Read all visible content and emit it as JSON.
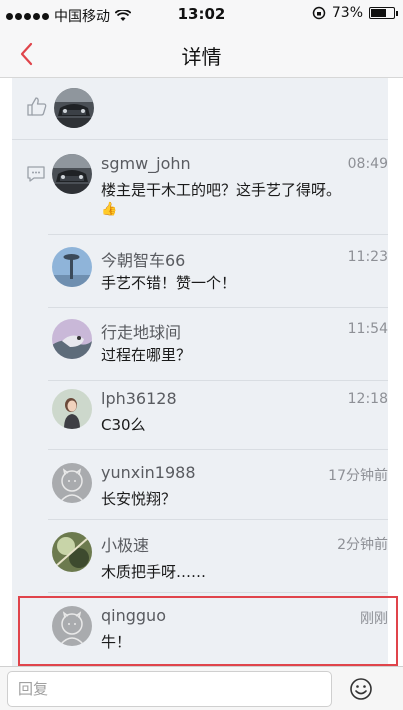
{
  "status_bar": {
    "carrier": "中国移动",
    "time": "13:02",
    "battery_text": "73%",
    "battery_level": 0.73
  },
  "nav": {
    "title": "详情"
  },
  "comments": [
    {
      "name": "sgmw_john",
      "time": "08:49",
      "text": "楼主是干木工的吧？这手艺了得呀。",
      "emoji": "👍"
    },
    {
      "name": "今朝智车66",
      "time": "11:23",
      "text": "手艺不错！赞一个！"
    },
    {
      "name": "行走地球间",
      "time": "11:54",
      "text": "过程在哪里？"
    },
    {
      "name": "lph36128",
      "time": "12:18",
      "text": "C30么"
    },
    {
      "name": "yunxin1988",
      "time": "17分钟前",
      "text": "长安悦翔？"
    },
    {
      "name": "小极速",
      "time": "2分钟前",
      "text": "木质把手呀……"
    },
    {
      "name": "qingguo",
      "time": "刚刚",
      "text": "牛！"
    }
  ],
  "reply": {
    "placeholder": "回复"
  },
  "colors": {
    "accent": "#e0444b",
    "content_bg": "#edf0f4",
    "name_text": "#595b60"
  }
}
